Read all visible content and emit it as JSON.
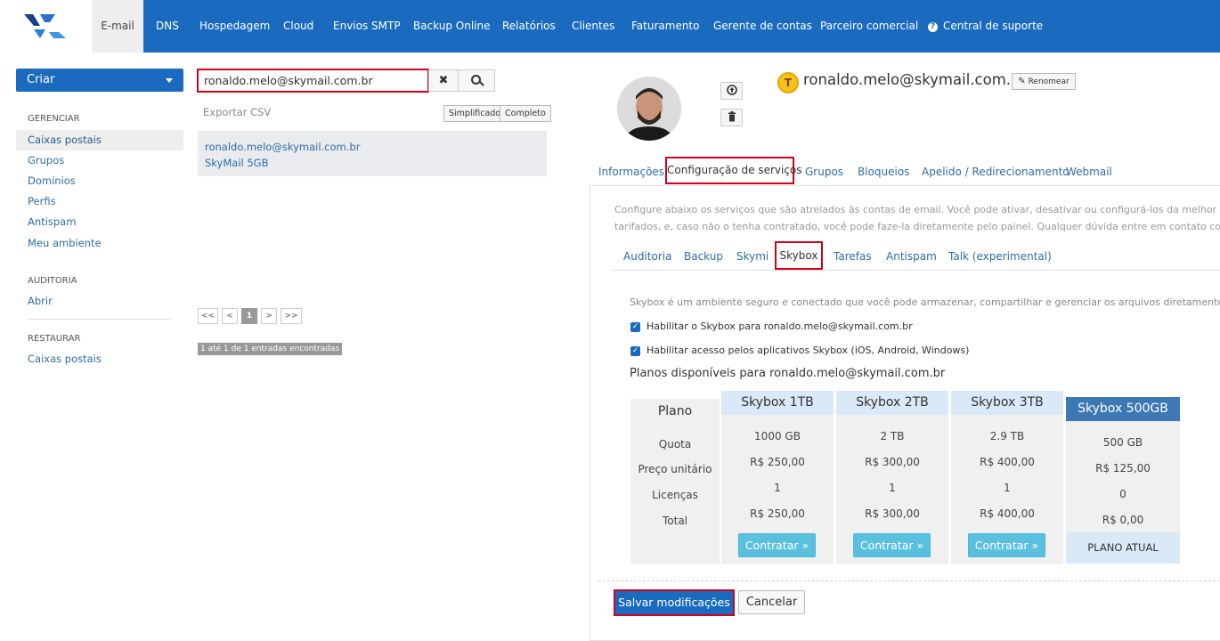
{
  "nav": {
    "items": [
      "E-mail",
      "DNS",
      "Hospedagem",
      "Cloud",
      "Envios SMTP",
      "Backup Online",
      "Relatórios",
      "Clientes",
      "Faturamento",
      "Gerente de contas",
      "Parceiro comercial",
      "Central de suporte"
    ],
    "active": "E-mail"
  },
  "sidebar": {
    "create_label": "Criar",
    "manage_head": "GERENCIAR",
    "manage_items": [
      "Caixas postais",
      "Grupos",
      "Domínios",
      "Perfis",
      "Antispam",
      "Meu ambiente"
    ],
    "audit_head": "AUDITORIA",
    "audit_items": [
      "Abrir"
    ],
    "restore_head": "RESTAURAR",
    "restore_items": [
      "Caixas postais"
    ]
  },
  "search": {
    "value": "ronaldo.melo@skymail.com.br",
    "clear_label": "✖",
    "export_csv": "Exportar CSV",
    "view_simple": "Simplificado",
    "view_full": "Completo"
  },
  "result": {
    "email": "ronaldo.melo@skymail.com.br",
    "plan": "SkyMail 5GB"
  },
  "pagination": {
    "first": "<<",
    "prev": "<",
    "current": "1",
    "next": ">",
    "last": ">>",
    "entries": "1 até 1 de 1 entradas encontradas"
  },
  "profile": {
    "initial": "T",
    "email": "ronaldo.melo@skymail.com.br",
    "rename_label": "Renomear"
  },
  "tabs": [
    "Informações",
    "Configuração de serviços",
    "Grupos",
    "Bloqueios",
    "Apelido / Redirecionamento",
    "Webmail"
  ],
  "services": {
    "desc_line1": "Configure abaixo os serviços que são atrelados às contas de email. Você pode ativar, desativar ou configurá-los da melhor maneira pro",
    "desc_line2": "tarifados, e, caso não o tenha contratado, você pode faze-la diretamente pelo painel. Qualquer dúvida entre em contato com o nosso su",
    "tabs": [
      "Auditoria",
      "Backup",
      "Skymi",
      "Skybox",
      "Tarefas",
      "Antispam",
      "Talk (experimental)"
    ]
  },
  "skybox": {
    "desc": "Skybox é um ambiente seguro e conectado que você pode armazenar, compartilhar e gerenciar os arquivos diretamente pelo webm",
    "check1": "Habilitar o Skybox para ronaldo.melo@skymail.com.br",
    "check2": "Habilitar acesso pelos aplicativos Skybox (iOS, Android, Windows)",
    "plans_title": "Planos disponíveis para ronaldo.melo@skymail.com.br",
    "row_head": "Plano",
    "row_labels": [
      "Quota",
      "Preço unitário",
      "Licenças",
      "Total"
    ],
    "plans": [
      {
        "name": "Skybox 1TB",
        "quota": "1000 GB",
        "price": "R$ 250,00",
        "licenses": "1",
        "total": "R$ 250,00",
        "action": "Contratar »"
      },
      {
        "name": "Skybox 2TB",
        "quota": "2 TB",
        "price": "R$ 300,00",
        "licenses": "1",
        "total": "R$ 300,00",
        "action": "Contratar »"
      },
      {
        "name": "Skybox 3TB",
        "quota": "2.9 TB",
        "price": "R$ 400,00",
        "licenses": "1",
        "total": "R$ 400,00",
        "action": "Contratar »"
      },
      {
        "name": "Skybox 500GB",
        "quota": "500 GB",
        "price": "R$ 125,00",
        "licenses": "0",
        "total": "R$ 0,00",
        "action": "PLANO ATUAL"
      }
    ]
  },
  "footer": {
    "save": "Salvar modificações",
    "cancel": "Cancelar"
  },
  "colors": {
    "brand": "#1a6bbf",
    "highlight": "#d0021b",
    "cta": "#5bc0de",
    "current_plan": "#3c78b4"
  }
}
